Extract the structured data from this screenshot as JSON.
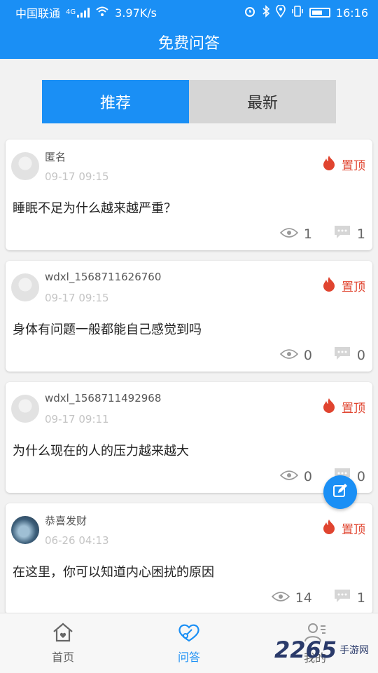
{
  "status_bar": {
    "carrier": "中国联通",
    "network": "4G",
    "speed": "3.97K/s",
    "time": "16:16"
  },
  "header": {
    "title": "免费问答"
  },
  "tabs": [
    {
      "label": "推荐",
      "active": true
    },
    {
      "label": "最新",
      "active": false
    }
  ],
  "posts": [
    {
      "user": "匿名",
      "time": "09-17 09:15",
      "pin_label": "置顶",
      "question": "睡眠不足为什么越来越严重？",
      "views": "1",
      "comments": "1",
      "avatar": "default"
    },
    {
      "user": "wdxl_1568711626760",
      "time": "09-17 09:15",
      "pin_label": "置顶",
      "question": "身体有问题一般都能自己感觉到吗",
      "views": "0",
      "comments": "0",
      "avatar": "default"
    },
    {
      "user": "wdxl_1568711492968",
      "time": "09-17 09:11",
      "pin_label": "置顶",
      "question": "为什么现在的人的压力越来越大",
      "views": "0",
      "comments": "0",
      "avatar": "default"
    },
    {
      "user": "恭喜发财",
      "time": "06-26 04:13",
      "pin_label": "置顶",
      "question": "在这里，你可以知道内心困扰的原因",
      "views": "14",
      "comments": "1",
      "avatar": "photo"
    }
  ],
  "bottom_nav": [
    {
      "label": "首页",
      "icon": "home-icon",
      "active": false
    },
    {
      "label": "问答",
      "icon": "qa-icon",
      "active": true
    },
    {
      "label": "我的",
      "icon": "user-icon",
      "active": false
    }
  ],
  "watermark": {
    "number": "2265",
    "text": "手游网"
  },
  "colors": {
    "primary": "#1a8ff5",
    "pin": "#e0442f"
  }
}
